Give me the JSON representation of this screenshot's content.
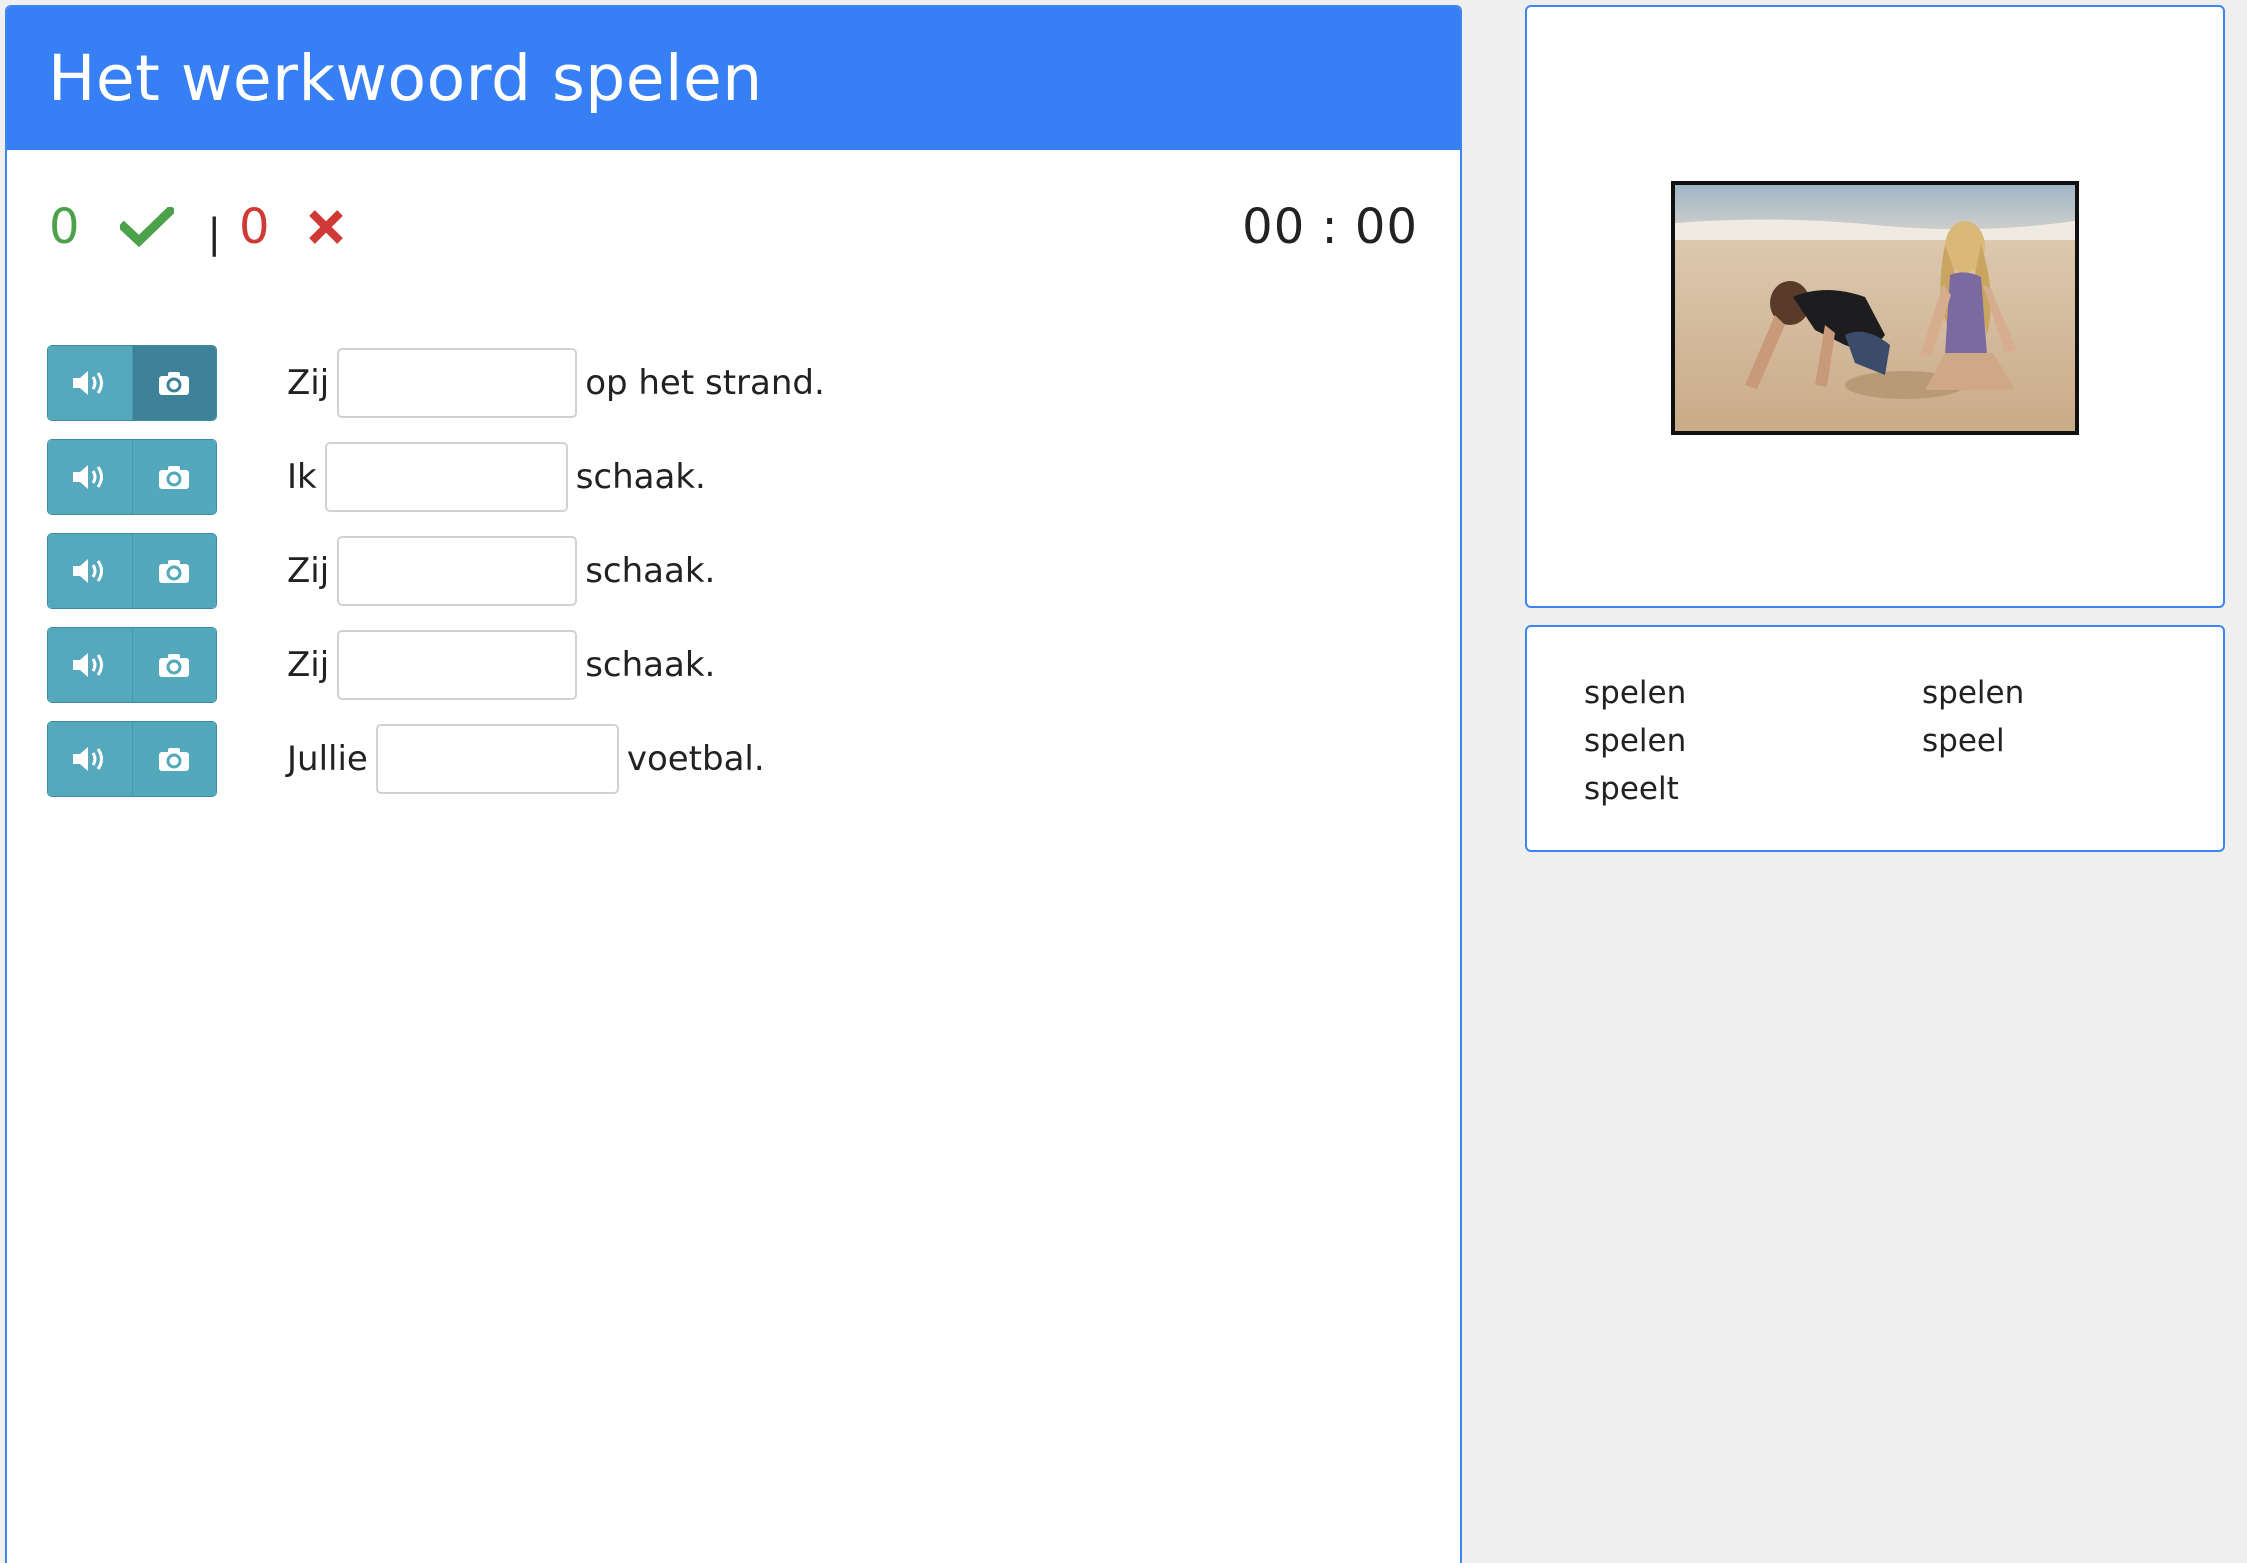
{
  "title": "Het werkwoord spelen",
  "score": {
    "correct": "0",
    "separator": "|",
    "wrong": "0",
    "timer": "00 : 00"
  },
  "colors": {
    "header": "#367ff5",
    "correct": "#4ca24a",
    "wrong": "#d03a36",
    "button": "#56a9bd",
    "button_active": "#3e8198"
  },
  "exercises": [
    {
      "before": "Zij",
      "after": "op het strand.",
      "value": "",
      "active_camera": true
    },
    {
      "before": "Ik",
      "after": "schaak.",
      "value": "",
      "active_camera": false
    },
    {
      "before": "Zij",
      "after": "schaak.",
      "value": "",
      "active_camera": false
    },
    {
      "before": "Zij",
      "after": "schaak.",
      "value": "",
      "active_camera": false
    },
    {
      "before": "Jullie",
      "after": "voetbal.",
      "value": "",
      "active_camera": false
    }
  ],
  "icons": {
    "audio": "speaker-icon",
    "camera": "camera-icon",
    "check": "check-icon",
    "cross": "cross-icon"
  },
  "word_bank": [
    "spelen",
    "spelen",
    "spelen",
    "speel",
    "speelt"
  ]
}
